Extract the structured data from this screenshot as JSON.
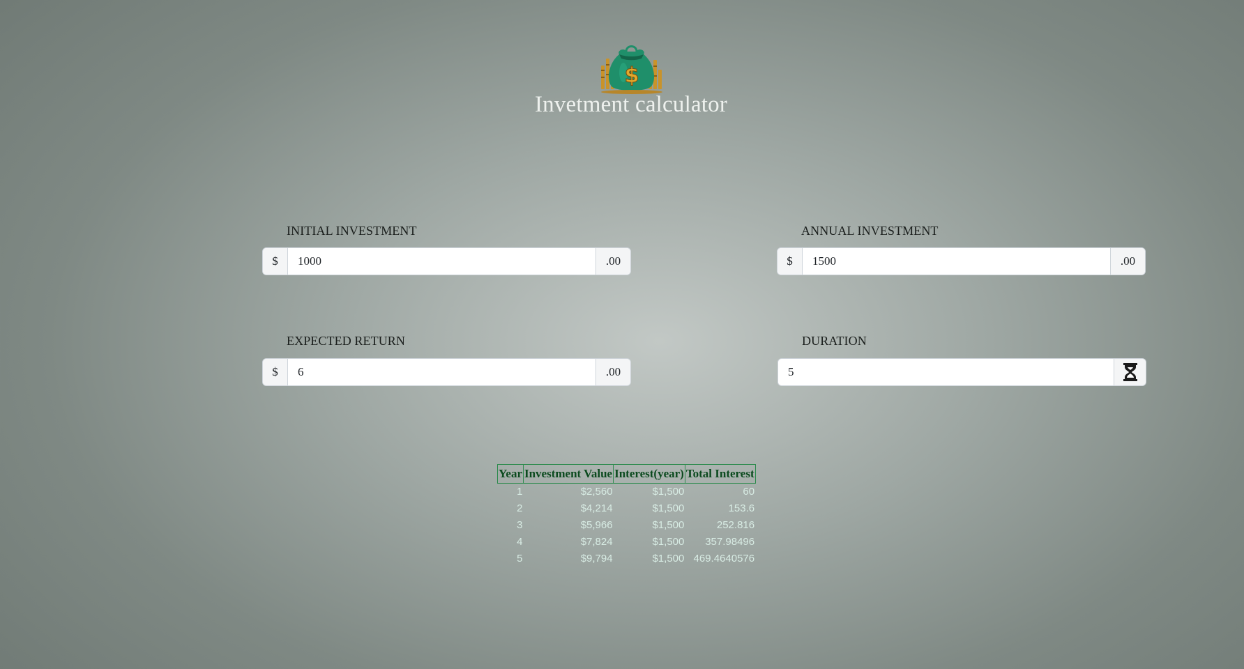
{
  "app": {
    "title": "Invetment calculator",
    "logo_icon": "money-bag-icon"
  },
  "fields": {
    "initial_investment": {
      "label": "INITIAL INVESTMENT",
      "prefix": "$",
      "value": "1000",
      "suffix": ".00"
    },
    "annual_investment": {
      "label": "ANNUAL INVESTMENT",
      "prefix": "$",
      "value": "1500",
      "suffix": ".00"
    },
    "expected_return": {
      "label": "EXPECTED RETURN",
      "prefix": "$",
      "value": "6",
      "suffix": ".00"
    },
    "duration": {
      "label": "DURATION",
      "value": "5",
      "icon": "hourglass-icon"
    }
  },
  "results": {
    "headers": [
      "Year",
      "Investment Value",
      "Interest(year)",
      "Total Interest"
    ],
    "rows": [
      [
        "1",
        "$2,560",
        "$1,500",
        "60"
      ],
      [
        "2",
        "$4,214",
        "$1,500",
        "153.6"
      ],
      [
        "3",
        "$5,966",
        "$1,500",
        "252.816"
      ],
      [
        "4",
        "$7,824",
        "$1,500",
        "357.98496"
      ],
      [
        "5",
        "$9,794",
        "$1,500",
        "469.4640576"
      ]
    ]
  },
  "colors": {
    "title": "#eef1ee",
    "table_header_text": "#0b4a1e",
    "table_border": "#2e8b4e",
    "table_cell_text": "#d8ece4",
    "logo_bag": "#1f8f6a",
    "logo_coin": "#e2a82c"
  }
}
